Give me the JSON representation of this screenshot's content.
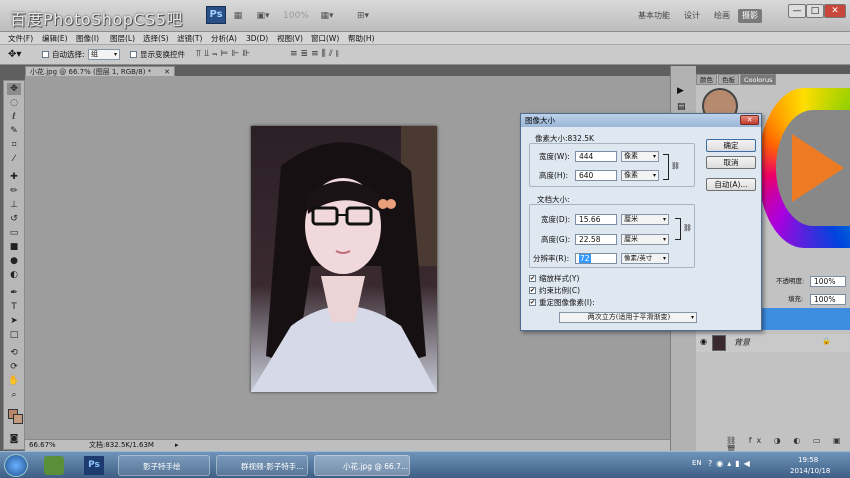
{
  "titlebar": {
    "brand": "百度PhotoShopCS5吧",
    "logo": "Ps",
    "zoom": "100%",
    "workspaces": [
      "基本功能",
      "设计",
      "绘画",
      "摄影"
    ],
    "active_workspace": "摄影",
    "window_buttons": [
      "—",
      "□",
      "✕"
    ]
  },
  "menu": [
    "文件(F)",
    "编辑(E)",
    "图像(I)",
    "图层(L)",
    "选择(S)",
    "滤镜(T)",
    "分析(A)",
    "3D(D)",
    "视图(V)",
    "窗口(W)",
    "帮助(H)"
  ],
  "options": {
    "auto_select_label": "自动选择:",
    "auto_select_value": "组",
    "show_transform_label": "显示变换控件"
  },
  "document": {
    "tab": "小花.jpg @ 66.7% (图层 1, RGB/8) *",
    "status_zoom": "66.67%",
    "status_doc": "文档:832.5K/1.63M"
  },
  "panels": {
    "tabs": [
      "颜色",
      "色板",
      "Coolorus"
    ],
    "opacity_label": "不透明度:",
    "opacity_value": "100%",
    "fill_label": "填充:",
    "fill_value": "100%",
    "layer_name": "背景"
  },
  "dialog": {
    "title": "图像大小",
    "pixel_dims_label": "像素大小:832.5K",
    "width_label": "宽度(W):",
    "width_value": "444",
    "width_unit": "像素",
    "height_label": "高度(H):",
    "height_value": "640",
    "height_unit": "像素",
    "doc_size_label": "文档大小:",
    "doc_width_label": "宽度(D):",
    "doc_width_value": "15.66",
    "doc_width_unit": "厘米",
    "doc_height_label": "高度(G):",
    "doc_height_value": "22.58",
    "doc_height_unit": "厘米",
    "resolution_label": "分辨率(R):",
    "resolution_value": "72",
    "resolution_unit": "像素/英寸",
    "scale_styles": "缩放样式(Y)",
    "constrain": "约束比例(C)",
    "resample": "重定图像像素(I):",
    "resample_method": "两次立方(适用于平滑渐变)",
    "ok": "确定",
    "cancel": "取消",
    "auto": "自动(A)..."
  },
  "taskbar": {
    "tasks": [
      "影子特手绘",
      "群视频-影子特手...",
      "小花.jpg @ 66.7..."
    ],
    "lang": "EN",
    "time": "19:58",
    "date": "2014/10/18"
  },
  "colors": {
    "accent": "#7a7a7a",
    "dialog_bg": "#dfe7f0",
    "selection_blue": "#3d8ee0"
  }
}
